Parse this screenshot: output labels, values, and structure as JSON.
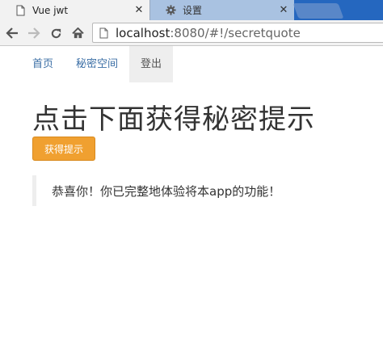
{
  "browser": {
    "tabs": [
      {
        "title": "Vue jwt",
        "active": true,
        "icon": "document-icon"
      },
      {
        "title": "设置",
        "active": false,
        "icon": "gear-icon"
      }
    ],
    "address": {
      "host": "localhost",
      "rest": ":8080/#!/secretquote"
    }
  },
  "nav": {
    "items": [
      {
        "label": "首页",
        "active": false
      },
      {
        "label": "秘密空间",
        "active": false
      },
      {
        "label": "登出",
        "active": true
      }
    ]
  },
  "main": {
    "heading": "点击下面获得秘密提示",
    "button_label": "获得提示",
    "quote": "恭喜你！你已完整地体验将本app的功能！"
  },
  "colors": {
    "tabstrip": "#2567bf",
    "toolbar": "#f2f2f2",
    "link": "#3c6fa6",
    "button": "#f0a030",
    "quote_border": "#eeeeee"
  }
}
